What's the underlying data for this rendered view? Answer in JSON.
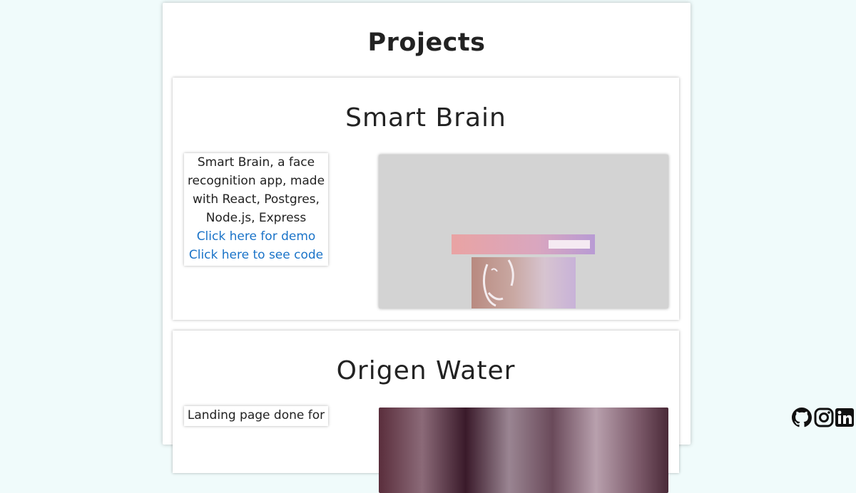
{
  "page": {
    "title": "Projects"
  },
  "projects": [
    {
      "name": "Smart Brain",
      "description": "Smart Brain, a face recognition app, made with React, Postgres, Node.js, Express",
      "demo_link": "Click here for demo",
      "code_link": "Click here to see code",
      "preview_alt": "smart-brain-preview"
    },
    {
      "name": "Origen Water",
      "description": "Landing page done for",
      "preview_alt": "origen-water-preview"
    }
  ],
  "social": [
    "github-icon",
    "instagram-icon",
    "linkedin-icon"
  ],
  "colors": {
    "background": "#f0fbfb",
    "link": "#1a73c8",
    "text": "#222222"
  }
}
